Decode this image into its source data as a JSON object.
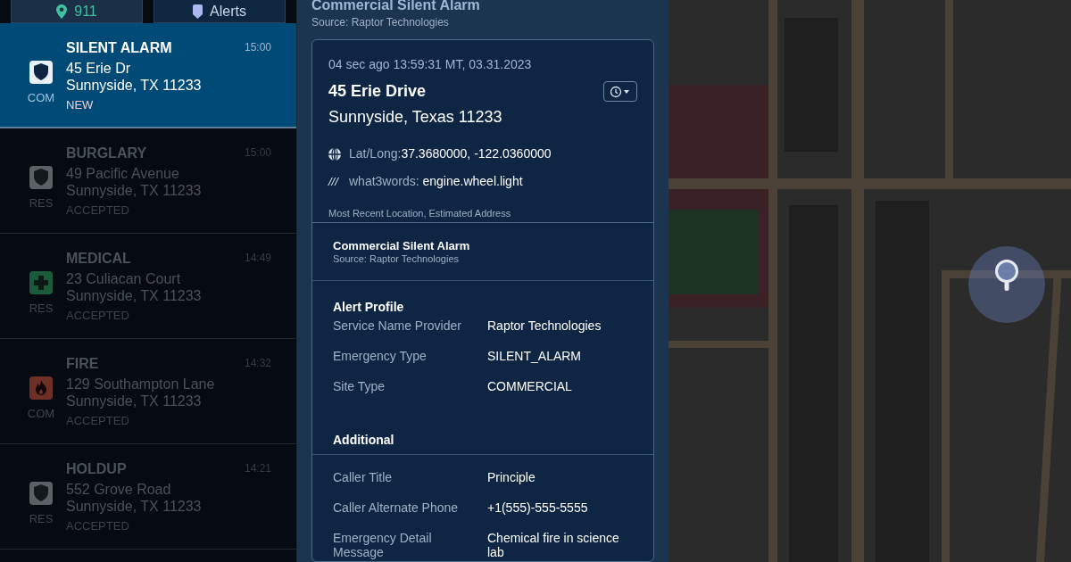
{
  "tabs": [
    {
      "label": "911",
      "kind": "pin",
      "selected": false
    },
    {
      "label": "Alerts",
      "kind": "tag",
      "selected": true
    }
  ],
  "incidents": [
    {
      "type": "SILENT ALARM",
      "kind": "police",
      "site": "COM",
      "address": "45 Erie Dr",
      "city": "Sunnyside, TX 11233",
      "status": "NEW",
      "time": "15:00",
      "selected": true
    },
    {
      "type": "BURGLARY",
      "kind": "police",
      "site": "RES",
      "address": "49 Pacific Avenue",
      "city": "Sunnyside, TX 11233",
      "status": "ACCEPTED",
      "time": "15:00",
      "selected": false
    },
    {
      "type": "MEDICAL",
      "kind": "medical",
      "site": "RES",
      "address": "23 Culiacan Court",
      "city": "Sunnyside, TX 11233",
      "status": "ACCEPTED",
      "time": "14:49",
      "selected": false
    },
    {
      "type": "FIRE",
      "kind": "fire",
      "site": "COM",
      "address": "129 Southampton Lane",
      "city": "Sunnyside, TX 11233",
      "status": "ACCEPTED",
      "time": "14:32",
      "selected": false
    },
    {
      "type": "HOLDUP",
      "kind": "police",
      "site": "RES",
      "address": "552 Grove Road",
      "city": "Sunnyside, TX 11233",
      "status": "ACCEPTED",
      "time": "14:21",
      "selected": false
    }
  ],
  "detail": {
    "title": "Commercial Silent Alarm",
    "source": "Source:  Raptor Technologies",
    "location": {
      "timestamp": "04 sec ago 13:59:31 MT, 03.31.2023",
      "street": "45 Erie Drive",
      "city": "Sunnyside, Texas 11233",
      "latlong_label": "Lat/Long:",
      "latlong": "37.3680000, -122.0360000",
      "w3w_mark": "///",
      "w3w_label": "what3words:",
      "w3w": "engine.wheel.light",
      "note": "Most Recent Location, Estimated Address"
    },
    "alert": {
      "title": "Commercial Silent Alarm",
      "source": "Source:  Raptor Technologies"
    },
    "sections": [
      {
        "heading": "Alert Profile",
        "rule_below_heading": false,
        "rows": [
          {
            "label": "Service Name Provider",
            "value": "Raptor Technologies"
          },
          {
            "label": "Emergency Type",
            "value": "SILENT_ALARM"
          },
          {
            "label": "Site Type",
            "value": "COMMERCIAL"
          }
        ]
      },
      {
        "heading": "Additional",
        "rule_below_heading": true,
        "rows": [
          {
            "label": "Caller Title",
            "value": "Principle"
          },
          {
            "label": "Caller Alternate Phone",
            "value": "+1(555)-555-5555"
          },
          {
            "label": "Emergency Detail Message",
            "value": "Chemical fire in science lab"
          }
        ]
      }
    ]
  }
}
